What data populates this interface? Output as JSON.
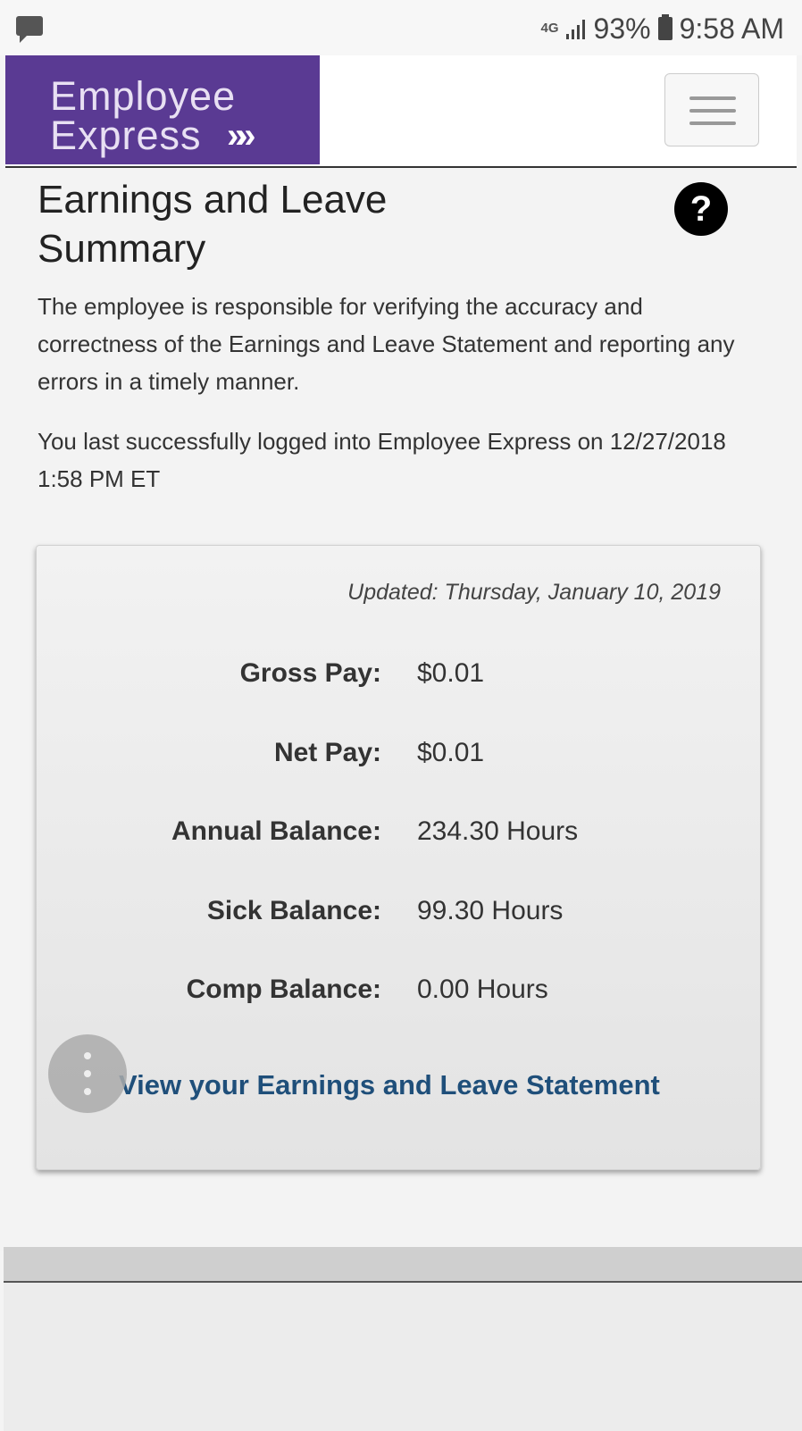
{
  "status_bar": {
    "network": "4G",
    "battery": "93%",
    "time": "9:58 AM"
  },
  "header": {
    "logo_line1": "Employee",
    "logo_line2": "Express",
    "logo_chevrons": "»»"
  },
  "page": {
    "title": "Earnings and Leave Summary",
    "help_label": "?",
    "intro": "The employee is responsible for verifying the accuracy and correctness of the Earnings and Leave Statement and reporting any errors in a timely manner.",
    "last_login": "You last successfully logged into Employee Express on 12/27/2018 1:58 PM ET"
  },
  "summary": {
    "updated": "Updated: Thursday, January 10, 2019",
    "rows": [
      {
        "label": "Gross Pay:",
        "value": "$0.01"
      },
      {
        "label": "Net Pay:",
        "value": "$0.01"
      },
      {
        "label": "Annual Balance:",
        "value": "234.30 Hours"
      },
      {
        "label": "Sick Balance:",
        "value": "99.30 Hours"
      },
      {
        "label": "Comp Balance:",
        "value": "0.00 Hours"
      }
    ],
    "statement_link": "View your Earnings and Leave Statement"
  },
  "colors": {
    "brand_purple": "#5a3a93",
    "link_blue": "#1f4f7a"
  }
}
